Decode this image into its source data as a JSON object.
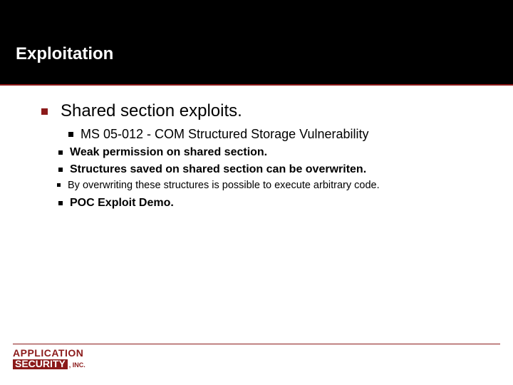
{
  "title": "Exploitation",
  "content": {
    "l1": "Shared section exploits.",
    "l2a": "MS 05-012 - COM Structured Storage Vulnerability",
    "l3a": "Weak permission on shared section.",
    "l3b": "Structures saved on shared section can be overwriten.",
    "l4a": "By overwriting these structures is possible to execute arbitrary code.",
    "l3c": "POC Exploit Demo."
  },
  "logo": {
    "line1": "APPLICATION",
    "line2": "SECURITY",
    "inc": ", INC."
  }
}
